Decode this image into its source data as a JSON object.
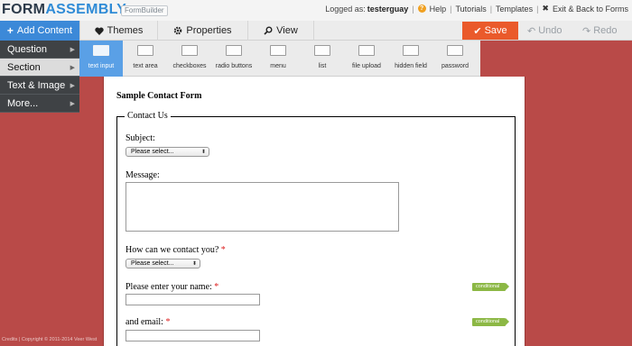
{
  "header": {
    "logo_part1": "FORM",
    "logo_part2": "ASSEMBLY",
    "product_tag": "FormBuilder",
    "logged_as_label": "Logged as:",
    "username": "testerguay",
    "links": [
      "Help",
      "Tutorials",
      "Templates",
      "Exit & Back to Forms"
    ]
  },
  "toolbar": {
    "add_content_label": "Add Content",
    "themes_label": "Themes",
    "properties_label": "Properties",
    "view_label": "View",
    "save_label": "Save",
    "undo_label": "Undo",
    "redo_label": "Redo",
    "accent_color": "#3c89d8",
    "save_color": "#ea5a2b"
  },
  "add_menu": {
    "items": [
      "Question",
      "Section",
      "Text & Image",
      "More..."
    ],
    "highlighted": "Section"
  },
  "palette": {
    "items": [
      "text input",
      "text area",
      "checkboxes",
      "radio buttons",
      "menu",
      "list",
      "file upload",
      "hidden field",
      "password"
    ],
    "active": "text input"
  },
  "form": {
    "title": "Sample Contact Form",
    "section_legend": "Contact Us",
    "subject_label": "Subject:",
    "subject_select": "Please select...",
    "message_label": "Message:",
    "contact_label": "How can we contact you?",
    "contact_select": "Please select...",
    "name_label": "Please enter your name:",
    "email_label": "and email:",
    "required_mark": "*",
    "conditional_badge": "conditional"
  },
  "footer": {
    "credits": "Credits | Copyright © 2011-2014 Veer West"
  }
}
